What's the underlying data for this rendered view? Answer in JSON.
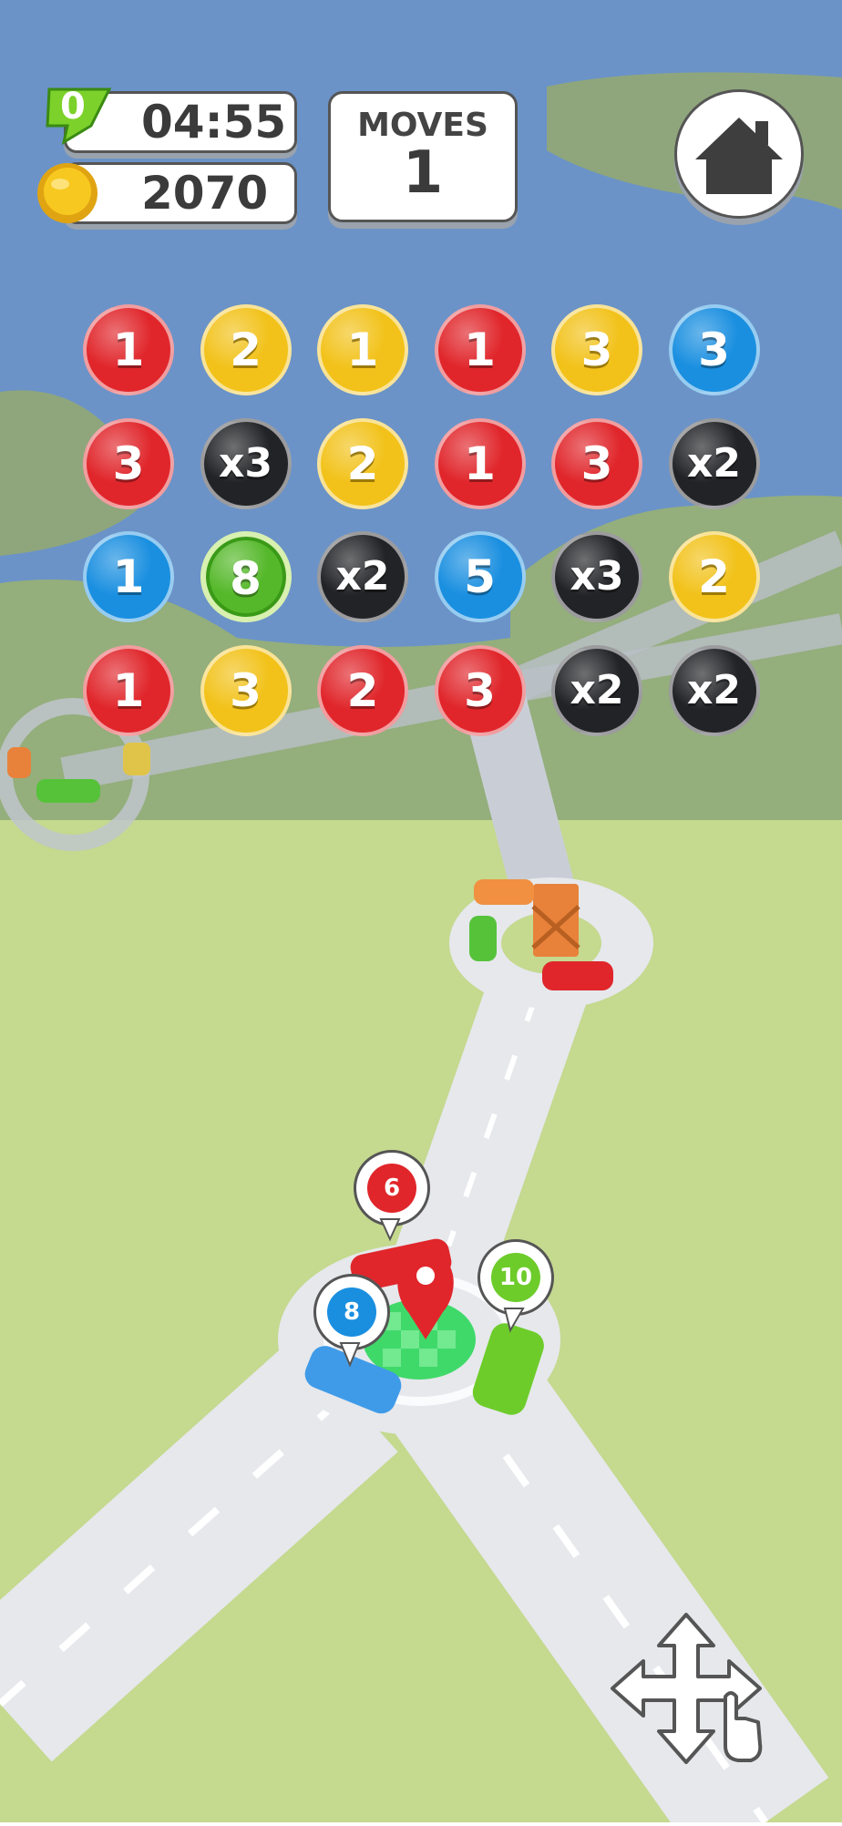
{
  "hud": {
    "timer_badge": "0",
    "timer": "04:55",
    "coins": "2070",
    "moves_label": "MOVES",
    "moves_value": "1"
  },
  "colors": {
    "red": "#e0262b",
    "yellow": "#f2c21a",
    "blue": "#1a8fe0",
    "black": "#222326",
    "green": "#55b82a",
    "water": "#6b93c8",
    "grass_top": "#94ae7c",
    "grass_bottom": "#c5d98f",
    "road": "#e6e8ec"
  },
  "board": {
    "rows": [
      [
        {
          "label": "1",
          "color": "red"
        },
        {
          "label": "2",
          "color": "yellow"
        },
        {
          "label": "1",
          "color": "yellow"
        },
        {
          "label": "1",
          "color": "red"
        },
        {
          "label": "3",
          "color": "yellow"
        },
        {
          "label": "3",
          "color": "blue"
        }
      ],
      [
        {
          "label": "3",
          "color": "red"
        },
        {
          "label": "x3",
          "color": "black"
        },
        {
          "label": "2",
          "color": "yellow"
        },
        {
          "label": "1",
          "color": "red"
        },
        {
          "label": "3",
          "color": "red"
        },
        {
          "label": "x2",
          "color": "black"
        }
      ],
      [
        {
          "label": "1",
          "color": "blue"
        },
        {
          "label": "8",
          "color": "green"
        },
        {
          "label": "x2",
          "color": "black"
        },
        {
          "label": "5",
          "color": "blue"
        },
        {
          "label": "x3",
          "color": "black"
        },
        {
          "label": "2",
          "color": "yellow"
        }
      ],
      [
        {
          "label": "1",
          "color": "red"
        },
        {
          "label": "3",
          "color": "yellow"
        },
        {
          "label": "2",
          "color": "red"
        },
        {
          "label": "3",
          "color": "red"
        },
        {
          "label": "x2",
          "color": "black"
        },
        {
          "label": "x2",
          "color": "black"
        }
      ]
    ]
  },
  "pins": [
    {
      "value": "6",
      "color": "red"
    },
    {
      "value": "8",
      "color": "blue"
    },
    {
      "value": "10",
      "color": "green"
    }
  ],
  "icons": {
    "home": "home-icon",
    "timer": "clock-badge-icon",
    "coin": "coin-icon",
    "move_hint": "move-arrows-hand-icon"
  }
}
